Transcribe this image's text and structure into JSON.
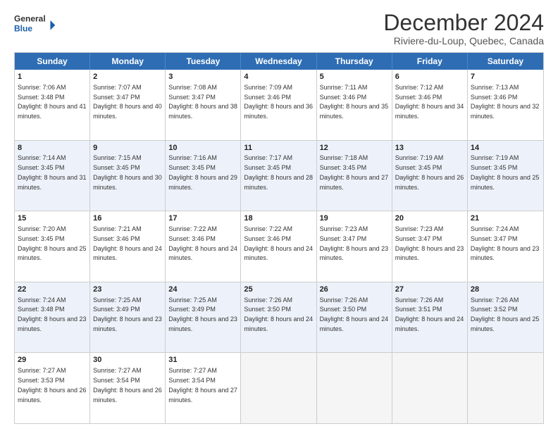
{
  "logo": {
    "line1": "General",
    "line2": "Blue"
  },
  "header": {
    "month": "December 2024",
    "location": "Riviere-du-Loup, Quebec, Canada"
  },
  "weekdays": [
    "Sunday",
    "Monday",
    "Tuesday",
    "Wednesday",
    "Thursday",
    "Friday",
    "Saturday"
  ],
  "weeks": [
    [
      {
        "day": "1",
        "sunrise": "Sunrise: 7:06 AM",
        "sunset": "Sunset: 3:48 PM",
        "daylight": "Daylight: 8 hours and 41 minutes."
      },
      {
        "day": "2",
        "sunrise": "Sunrise: 7:07 AM",
        "sunset": "Sunset: 3:47 PM",
        "daylight": "Daylight: 8 hours and 40 minutes."
      },
      {
        "day": "3",
        "sunrise": "Sunrise: 7:08 AM",
        "sunset": "Sunset: 3:47 PM",
        "daylight": "Daylight: 8 hours and 38 minutes."
      },
      {
        "day": "4",
        "sunrise": "Sunrise: 7:09 AM",
        "sunset": "Sunset: 3:46 PM",
        "daylight": "Daylight: 8 hours and 36 minutes."
      },
      {
        "day": "5",
        "sunrise": "Sunrise: 7:11 AM",
        "sunset": "Sunset: 3:46 PM",
        "daylight": "Daylight: 8 hours and 35 minutes."
      },
      {
        "day": "6",
        "sunrise": "Sunrise: 7:12 AM",
        "sunset": "Sunset: 3:46 PM",
        "daylight": "Daylight: 8 hours and 34 minutes."
      },
      {
        "day": "7",
        "sunrise": "Sunrise: 7:13 AM",
        "sunset": "Sunset: 3:46 PM",
        "daylight": "Daylight: 8 hours and 32 minutes."
      }
    ],
    [
      {
        "day": "8",
        "sunrise": "Sunrise: 7:14 AM",
        "sunset": "Sunset: 3:45 PM",
        "daylight": "Daylight: 8 hours and 31 minutes."
      },
      {
        "day": "9",
        "sunrise": "Sunrise: 7:15 AM",
        "sunset": "Sunset: 3:45 PM",
        "daylight": "Daylight: 8 hours and 30 minutes."
      },
      {
        "day": "10",
        "sunrise": "Sunrise: 7:16 AM",
        "sunset": "Sunset: 3:45 PM",
        "daylight": "Daylight: 8 hours and 29 minutes."
      },
      {
        "day": "11",
        "sunrise": "Sunrise: 7:17 AM",
        "sunset": "Sunset: 3:45 PM",
        "daylight": "Daylight: 8 hours and 28 minutes."
      },
      {
        "day": "12",
        "sunrise": "Sunrise: 7:18 AM",
        "sunset": "Sunset: 3:45 PM",
        "daylight": "Daylight: 8 hours and 27 minutes."
      },
      {
        "day": "13",
        "sunrise": "Sunrise: 7:19 AM",
        "sunset": "Sunset: 3:45 PM",
        "daylight": "Daylight: 8 hours and 26 minutes."
      },
      {
        "day": "14",
        "sunrise": "Sunrise: 7:19 AM",
        "sunset": "Sunset: 3:45 PM",
        "daylight": "Daylight: 8 hours and 25 minutes."
      }
    ],
    [
      {
        "day": "15",
        "sunrise": "Sunrise: 7:20 AM",
        "sunset": "Sunset: 3:45 PM",
        "daylight": "Daylight: 8 hours and 25 minutes."
      },
      {
        "day": "16",
        "sunrise": "Sunrise: 7:21 AM",
        "sunset": "Sunset: 3:46 PM",
        "daylight": "Daylight: 8 hours and 24 minutes."
      },
      {
        "day": "17",
        "sunrise": "Sunrise: 7:22 AM",
        "sunset": "Sunset: 3:46 PM",
        "daylight": "Daylight: 8 hours and 24 minutes."
      },
      {
        "day": "18",
        "sunrise": "Sunrise: 7:22 AM",
        "sunset": "Sunset: 3:46 PM",
        "daylight": "Daylight: 8 hours and 24 minutes."
      },
      {
        "day": "19",
        "sunrise": "Sunrise: 7:23 AM",
        "sunset": "Sunset: 3:47 PM",
        "daylight": "Daylight: 8 hours and 23 minutes."
      },
      {
        "day": "20",
        "sunrise": "Sunrise: 7:23 AM",
        "sunset": "Sunset: 3:47 PM",
        "daylight": "Daylight: 8 hours and 23 minutes."
      },
      {
        "day": "21",
        "sunrise": "Sunrise: 7:24 AM",
        "sunset": "Sunset: 3:47 PM",
        "daylight": "Daylight: 8 hours and 23 minutes."
      }
    ],
    [
      {
        "day": "22",
        "sunrise": "Sunrise: 7:24 AM",
        "sunset": "Sunset: 3:48 PM",
        "daylight": "Daylight: 8 hours and 23 minutes."
      },
      {
        "day": "23",
        "sunrise": "Sunrise: 7:25 AM",
        "sunset": "Sunset: 3:49 PM",
        "daylight": "Daylight: 8 hours and 23 minutes."
      },
      {
        "day": "24",
        "sunrise": "Sunrise: 7:25 AM",
        "sunset": "Sunset: 3:49 PM",
        "daylight": "Daylight: 8 hours and 23 minutes."
      },
      {
        "day": "25",
        "sunrise": "Sunrise: 7:26 AM",
        "sunset": "Sunset: 3:50 PM",
        "daylight": "Daylight: 8 hours and 24 minutes."
      },
      {
        "day": "26",
        "sunrise": "Sunrise: 7:26 AM",
        "sunset": "Sunset: 3:50 PM",
        "daylight": "Daylight: 8 hours and 24 minutes."
      },
      {
        "day": "27",
        "sunrise": "Sunrise: 7:26 AM",
        "sunset": "Sunset: 3:51 PM",
        "daylight": "Daylight: 8 hours and 24 minutes."
      },
      {
        "day": "28",
        "sunrise": "Sunrise: 7:26 AM",
        "sunset": "Sunset: 3:52 PM",
        "daylight": "Daylight: 8 hours and 25 minutes."
      }
    ],
    [
      {
        "day": "29",
        "sunrise": "Sunrise: 7:27 AM",
        "sunset": "Sunset: 3:53 PM",
        "daylight": "Daylight: 8 hours and 26 minutes."
      },
      {
        "day": "30",
        "sunrise": "Sunrise: 7:27 AM",
        "sunset": "Sunset: 3:54 PM",
        "daylight": "Daylight: 8 hours and 26 minutes."
      },
      {
        "day": "31",
        "sunrise": "Sunrise: 7:27 AM",
        "sunset": "Sunset: 3:54 PM",
        "daylight": "Daylight: 8 hours and 27 minutes."
      },
      {
        "day": "",
        "sunrise": "",
        "sunset": "",
        "daylight": ""
      },
      {
        "day": "",
        "sunrise": "",
        "sunset": "",
        "daylight": ""
      },
      {
        "day": "",
        "sunrise": "",
        "sunset": "",
        "daylight": ""
      },
      {
        "day": "",
        "sunrise": "",
        "sunset": "",
        "daylight": ""
      }
    ]
  ]
}
